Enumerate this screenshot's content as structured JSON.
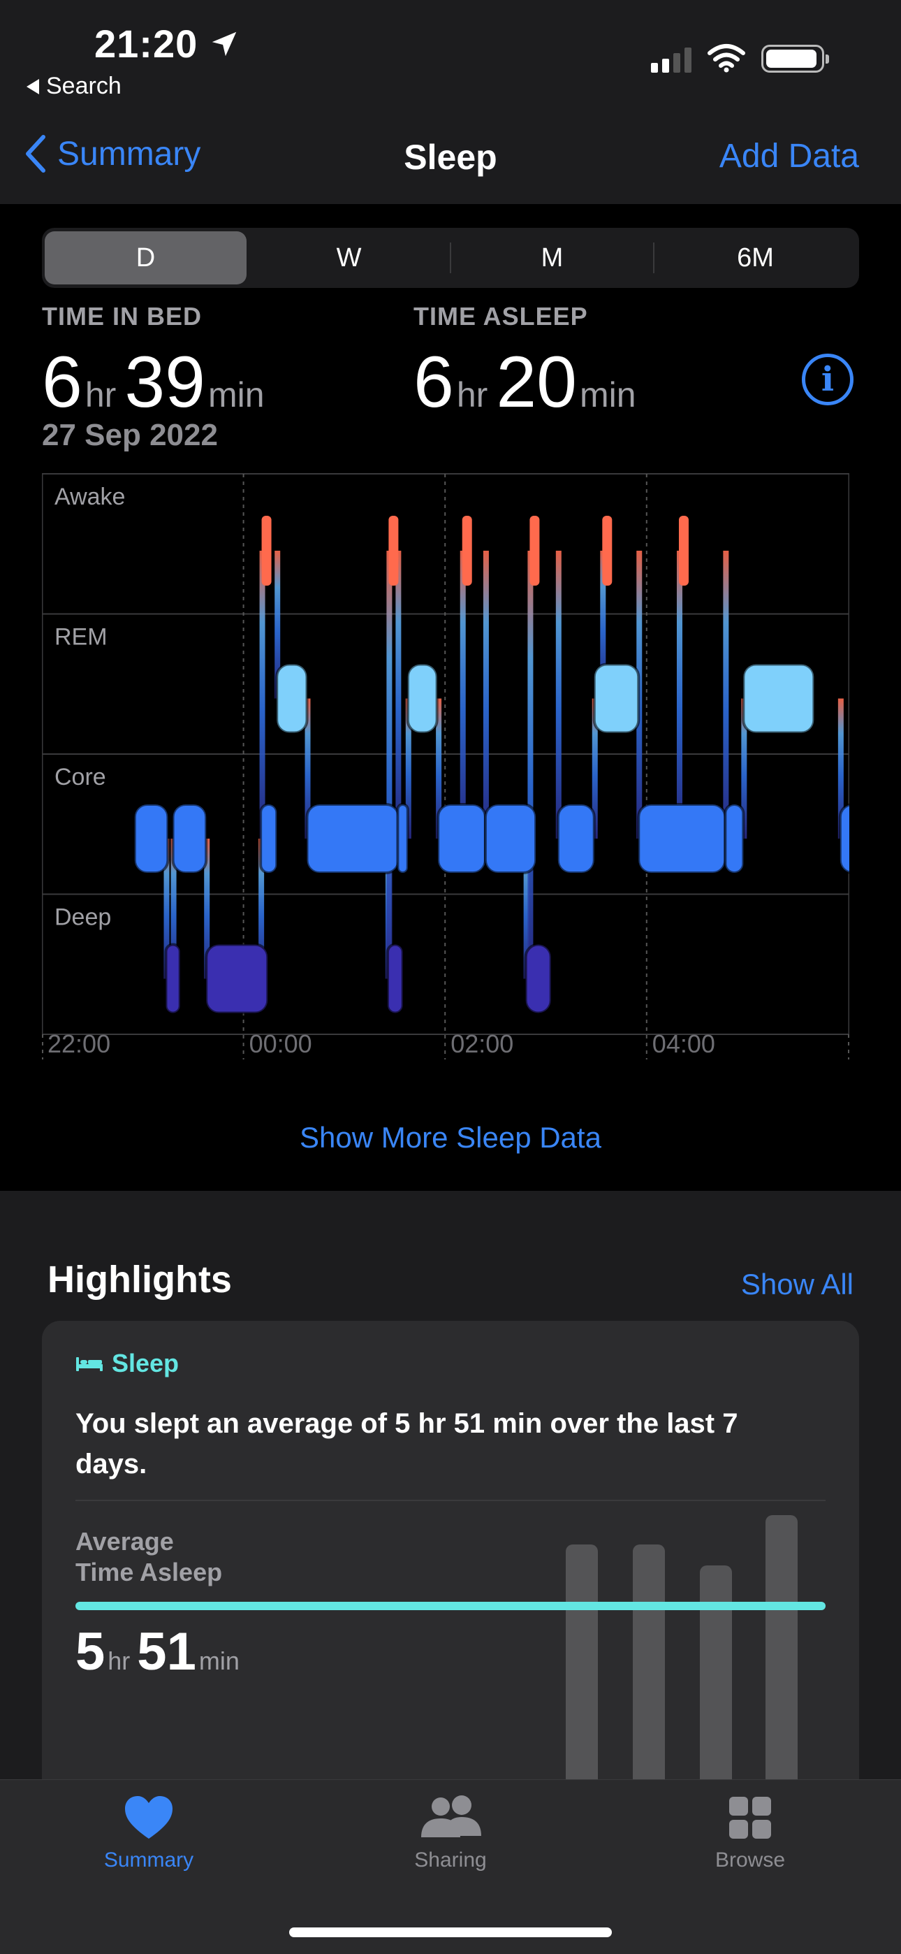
{
  "status_bar": {
    "time": "21:20",
    "back_app_label": "Search"
  },
  "nav": {
    "back_label": "Summary",
    "title": "Sleep",
    "action_label": "Add Data"
  },
  "segments": [
    {
      "label": "D",
      "selected": true
    },
    {
      "label": "W",
      "selected": false
    },
    {
      "label": "M",
      "selected": false
    },
    {
      "label": "6M",
      "selected": false
    }
  ],
  "stats": {
    "time_in_bed_label": "TIME IN BED",
    "time_in_bed_hr": "6",
    "time_in_bed_min": "39",
    "time_asleep_label": "TIME ASLEEP",
    "time_asleep_hr": "6",
    "time_asleep_min": "20",
    "unit_hr": "hr",
    "unit_min": "min",
    "date": "27 Sep 2022"
  },
  "chart_data": {
    "type": "hypnogram",
    "stages": [
      "Awake",
      "REM",
      "Core",
      "Deep"
    ],
    "x_ticks": [
      "22:00",
      "00:00",
      "02:00",
      "04:00"
    ],
    "x_range_hours": [
      22.0,
      28.0
    ],
    "stage_colors": {
      "Awake": "#ff6a4d",
      "REM": "#7fd0fb",
      "Core": "#3478f6",
      "Deep": "#3a2fb0"
    },
    "segments": [
      {
        "stage": "Core",
        "start": 22.92,
        "end": 23.25
      },
      {
        "stage": "Deep",
        "start": 23.23,
        "end": 23.37
      },
      {
        "stage": "Core",
        "start": 23.3,
        "end": 23.63
      },
      {
        "stage": "Deep",
        "start": 23.63,
        "end": 24.24
      },
      {
        "stage": "Awake",
        "start": 24.18,
        "end": 24.24
      },
      {
        "stage": "Core",
        "start": 24.17,
        "end": 24.33
      },
      {
        "stage": "REM",
        "start": 24.33,
        "end": 24.63
      },
      {
        "stage": "Core",
        "start": 24.63,
        "end": 25.54
      },
      {
        "stage": "Awake",
        "start": 25.44,
        "end": 25.53
      },
      {
        "stage": "Deep",
        "start": 25.43,
        "end": 25.58
      },
      {
        "stage": "Core",
        "start": 25.53,
        "end": 25.63
      },
      {
        "stage": "REM",
        "start": 25.63,
        "end": 25.92
      },
      {
        "stage": "Core",
        "start": 25.93,
        "end": 26.4
      },
      {
        "stage": "Awake",
        "start": 26.17,
        "end": 26.23
      },
      {
        "stage": "Core",
        "start": 26.4,
        "end": 26.9
      },
      {
        "stage": "Awake",
        "start": 26.84,
        "end": 26.93
      },
      {
        "stage": "Deep",
        "start": 26.8,
        "end": 27.05
      },
      {
        "stage": "Core",
        "start": 27.12,
        "end": 27.48
      },
      {
        "stage": "REM",
        "start": 27.48,
        "end": 27.92
      },
      {
        "stage": "Awake",
        "start": 27.56,
        "end": 27.65
      },
      {
        "stage": "Core",
        "start": 27.92,
        "end": 28.78
      },
      {
        "stage": "Core",
        "start": 28.78,
        "end": 28.96
      },
      {
        "stage": "Awake",
        "start": 28.32,
        "end": 28.4
      },
      {
        "stage": "REM",
        "start": 28.96,
        "end": 29.66
      },
      {
        "stage": "Core",
        "start": 29.92,
        "end": 30.2
      }
    ]
  },
  "show_more_label": "Show More Sleep Data",
  "highlights": {
    "title": "Highlights",
    "show_all_label": "Show All",
    "card": {
      "category": "Sleep",
      "text": "You slept an average of 5 hr 51 min over the last 7 days.",
      "avg_label_line1": "Average",
      "avg_label_line2": "Time Asleep",
      "avg_hr": "5",
      "avg_min": "51",
      "unit_hr": "hr",
      "unit_min": "min",
      "accent": "#63e6e2"
    }
  },
  "tabbar": {
    "items": [
      {
        "label": "Summary",
        "icon": "heart-icon",
        "active": true
      },
      {
        "label": "Sharing",
        "icon": "people-icon",
        "active": false
      },
      {
        "label": "Browse",
        "icon": "grid-icon",
        "active": false
      }
    ]
  }
}
